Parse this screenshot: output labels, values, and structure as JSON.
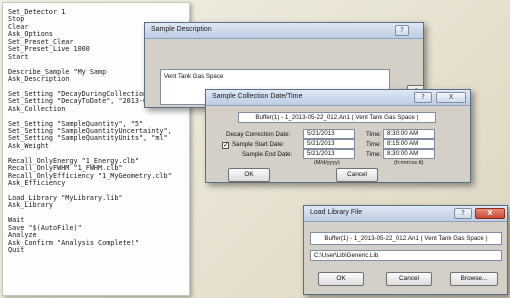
{
  "script": {
    "lines": [
      "Set_Detector 1",
      "Stop",
      "Clear",
      "Ask_Options",
      "Set_Preset_Clear",
      "Set_Preset_Live 1000",
      "Start",
      "",
      "Describe_Sample \"My Samp",
      "Ask_Description",
      "",
      "Set_Setting \"DecayDuringCollectionEnabled",
      "Set_Setting \"DecayToDate\", \"2013-08-12 18",
      "Ask_Collection",
      "",
      "Set_Setting \"SampleQuantity\", \"5\"",
      "Set_Setting \"SampleQuantityUncertainty\",",
      "Set_Setting \"SampleQuantityUnits\", \"ml\"",
      "Ask_Weight",
      "",
      "Recall_OnlyEnergy \"1_Energy.clb\"",
      "Recall_OnlyFWHM \"1_FWHM.clb\"",
      "Recall_OnlyEfficiency \"1_MyGeometry.clb\"",
      "Ask_Efficiency",
      "",
      "Load_Library \"MyLibrary.lib\"",
      "Ask_Library",
      "",
      "Wait",
      "Save \"$(AutoFile)\"",
      "Analyze",
      "Ask_Confirm \"Analysis Complete!\"",
      "Quit"
    ]
  },
  "sample_description": {
    "title": "Sample Description",
    "help_button": "?",
    "text": "Vent Tank Gas Space",
    "partial_button": "Ca"
  },
  "sample_collection": {
    "title": "Sample Collection Date/Time",
    "help_button": "?",
    "close_button": "X",
    "header": "Buffer(1) - 1_2013-05-22_012.An1 ( Vent Tank Gas Space )",
    "rows": [
      {
        "label": "Decay Correction Date:",
        "date": "5/21/2013",
        "time_label": "Time:",
        "time": "8:30:00 AM",
        "checked": null
      },
      {
        "label": "Sample Start Date:",
        "date": "5/21/2013",
        "time_label": "Time:",
        "time": "8:15:00 AM",
        "checked": true
      },
      {
        "label": "Sample End Date:",
        "date": "5/21/2013",
        "time_label": "Time:",
        "time": "8:30:00 AM",
        "checked": null
      }
    ],
    "date_format": "(M/d/yyyy)",
    "time_format": "(h:mm:ss tt)",
    "ok_label": "OK",
    "cancel_label": "Cancel"
  },
  "load_library": {
    "title": "Load Library File",
    "help_button": "?",
    "close_button": "X",
    "header": "Buffer(1) - 1_2013-05-22_012.An1 ( Vent Tank Gas Space )",
    "path": "C:\\User\\Lib\\Generic.Lib",
    "ok_label": "OK",
    "cancel_label": "Cancel",
    "browse_label": "Browse..."
  }
}
